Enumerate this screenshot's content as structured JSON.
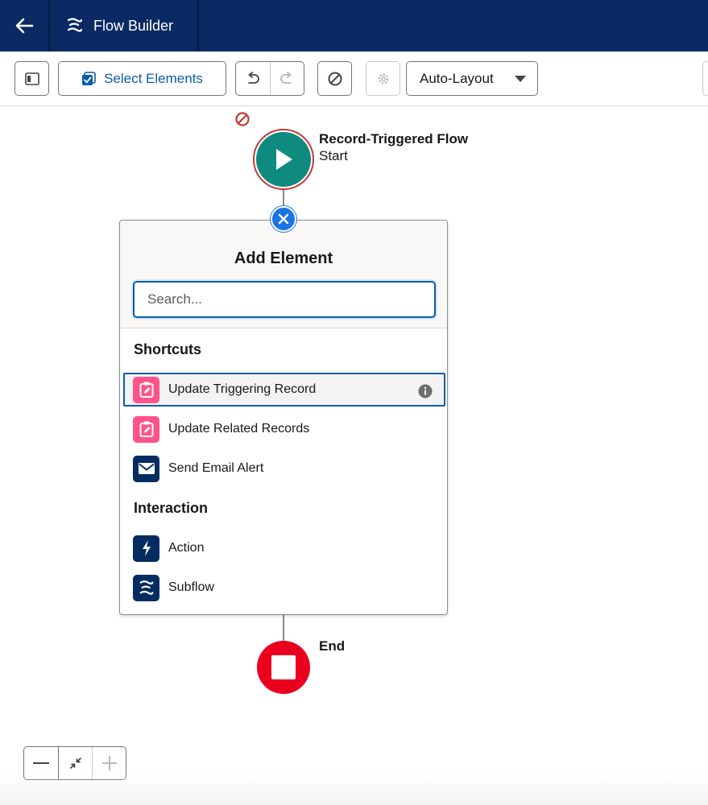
{
  "header": {
    "title": "Flow Builder",
    "back_icon": "arrow-left-icon",
    "app_icon": "flow-icon"
  },
  "toolbar": {
    "select_elements_label": "Select Elements",
    "layout_value": "Auto-Layout"
  },
  "canvas": {
    "start_node": {
      "title": "Record-Triggered Flow",
      "subtitle": "Start"
    },
    "end_node": {
      "label": "End"
    }
  },
  "add_element_panel": {
    "title": "Add Element",
    "search_placeholder": "Search...",
    "sections": [
      {
        "label": "Shortcuts",
        "items": [
          {
            "label": "Update Triggering Record",
            "icon": "record-update-icon",
            "color": "#ff538a",
            "selected": true
          },
          {
            "label": "Update Related Records",
            "icon": "record-update-icon",
            "color": "#ff538a",
            "selected": false
          },
          {
            "label": "Send Email Alert",
            "icon": "email-icon",
            "color": "#032d60",
            "selected": false
          }
        ]
      },
      {
        "label": "Interaction",
        "items": [
          {
            "label": "Action",
            "icon": "lightning-icon",
            "color": "#032d60",
            "selected": false
          },
          {
            "label": "Subflow",
            "icon": "subflow-icon",
            "color": "#032d60",
            "selected": false
          }
        ]
      }
    ]
  },
  "colors": {
    "header_bg": "#0b2a63",
    "brand_blue": "#0b5cab",
    "start_teal": "#0f8a7e",
    "end_red": "#ea001e",
    "close_blue": "#1b74e4"
  }
}
